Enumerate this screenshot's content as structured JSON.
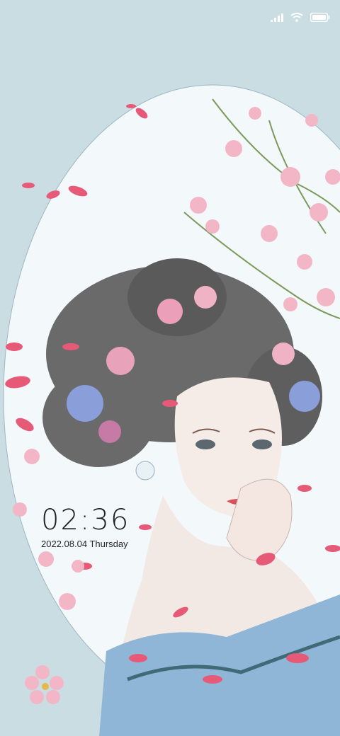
{
  "status_bar": {
    "icons": [
      "signal-icon",
      "wifi-icon",
      "battery-icon"
    ]
  },
  "lock_screen": {
    "time": "02:36",
    "date": "2022.08.04 Thursday"
  },
  "wallpaper": {
    "colors": {
      "background": "#c9dde3",
      "oval_fill": "#f3f8fb",
      "petal_pink": "#e65a78",
      "blossom_pink": "#f3b6c6",
      "hair": "#5c5c5c",
      "dress_blue": "#8fb6d6"
    }
  }
}
